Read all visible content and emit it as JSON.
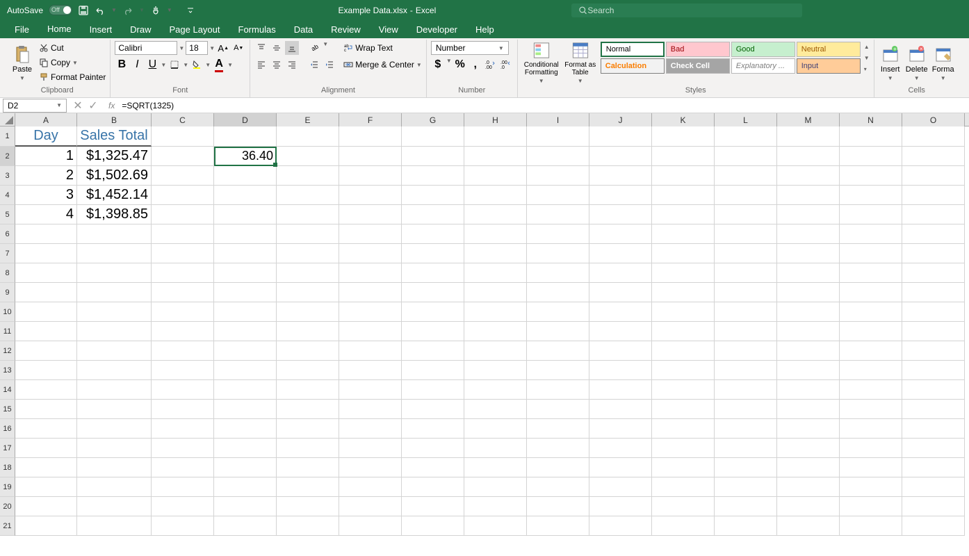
{
  "title_bar": {
    "autosave_label": "AutoSave",
    "autosave_state": "Off",
    "filename": "Example Data.xlsx",
    "separator": "-",
    "app": "Excel",
    "search_placeholder": "Search"
  },
  "tabs": [
    "File",
    "Home",
    "Insert",
    "Draw",
    "Page Layout",
    "Formulas",
    "Data",
    "Review",
    "View",
    "Developer",
    "Help"
  ],
  "active_tab": "Home",
  "ribbon": {
    "clipboard": {
      "paste": "Paste",
      "cut": "Cut",
      "copy": "Copy",
      "format_painter": "Format Painter",
      "group": "Clipboard"
    },
    "font": {
      "name": "Calibri",
      "size": "18",
      "group": "Font"
    },
    "alignment": {
      "wrap_text": "Wrap Text",
      "merge": "Merge & Center",
      "group": "Alignment"
    },
    "number": {
      "format": "Number",
      "group": "Number"
    },
    "styles": {
      "cond_fmt": "Conditional Formatting",
      "fmt_table": "Format as Table",
      "normal": "Normal",
      "bad": "Bad",
      "good": "Good",
      "neutral": "Neutral",
      "calculation": "Calculation",
      "check_cell": "Check Cell",
      "explanatory": "Explanatory ...",
      "input": "Input",
      "group": "Styles"
    },
    "cells": {
      "insert": "Insert",
      "delete": "Delete",
      "format": "Forma",
      "group": "Cells"
    }
  },
  "formula_bar": {
    "cell_ref": "D2",
    "formula": "=SQRT(1325)"
  },
  "grid": {
    "col_labels": [
      "A",
      "B",
      "C",
      "D",
      "E",
      "F",
      "G",
      "H",
      "I",
      "J",
      "K",
      "L",
      "M",
      "N",
      "O"
    ],
    "row_labels": [
      "1",
      "2",
      "3",
      "4",
      "5",
      "6",
      "7",
      "8",
      "9",
      "10",
      "11",
      "12",
      "13",
      "14",
      "15",
      "16",
      "17",
      "18",
      "19",
      "20",
      "21"
    ],
    "active_cell": "D2",
    "headers": {
      "A1": "Day",
      "B1": "Sales Total"
    },
    "data": [
      {
        "day": "1",
        "sales": "$1,325.47"
      },
      {
        "day": "2",
        "sales": "$1,502.69"
      },
      {
        "day": "3",
        "sales": "$1,452.14"
      },
      {
        "day": "4",
        "sales": "$1,398.85"
      }
    ],
    "d2_value": "36.40"
  }
}
